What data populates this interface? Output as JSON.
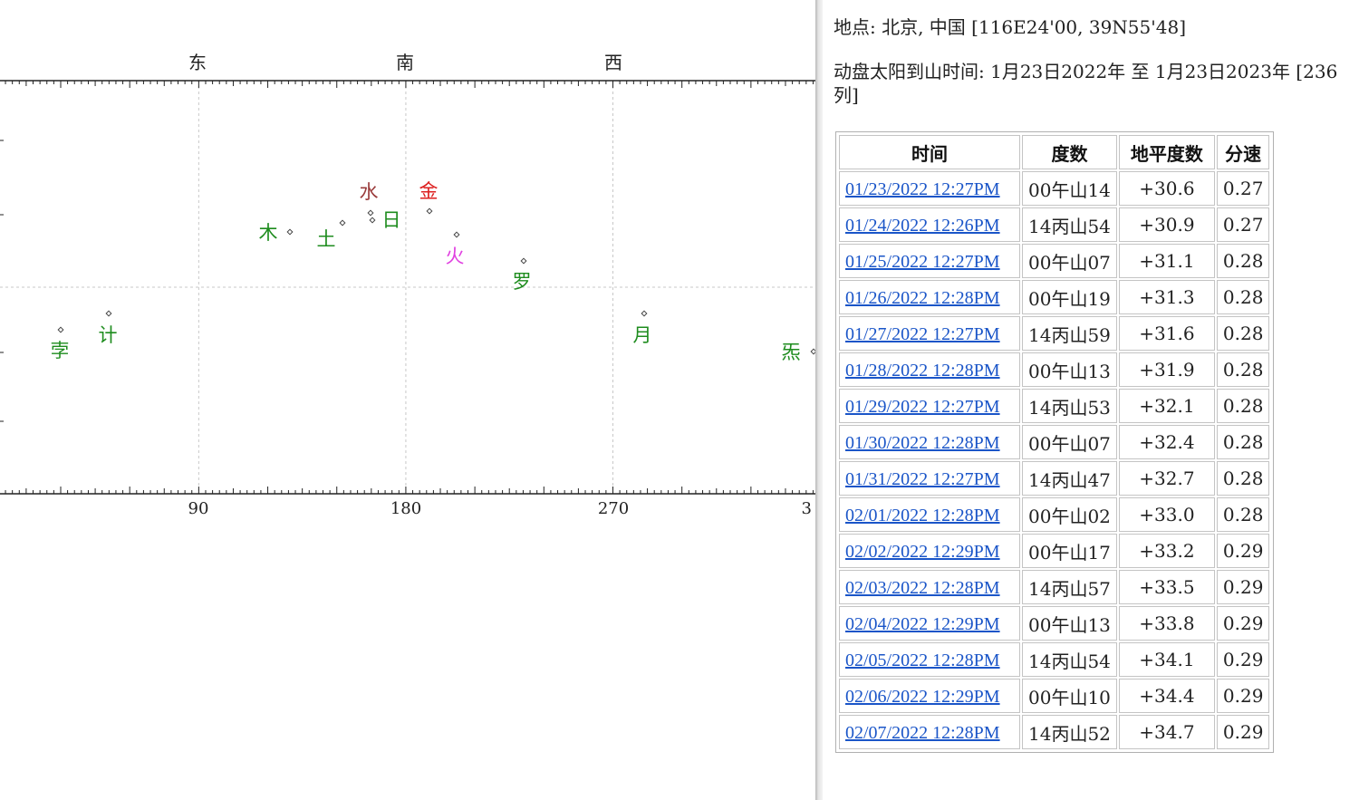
{
  "chart": {
    "directions": [
      "东",
      "南",
      "西"
    ],
    "x_ticks": [
      "90",
      "180",
      "270",
      "3"
    ],
    "colors": {
      "green": "#1e8c1e",
      "red": "#dd2020",
      "brown": "#9a3b3b",
      "magenta": "#e040e0",
      "grid": "#c8c8c8"
    },
    "bodies": [
      {
        "label": "孛",
        "color": "#1e8c1e"
      },
      {
        "label": "计",
        "color": "#1e8c1e"
      },
      {
        "label": "木",
        "color": "#1e8c1e"
      },
      {
        "label": "土",
        "color": "#1e8c1e"
      },
      {
        "label": "水",
        "color": "#9a3b3b"
      },
      {
        "label": "日",
        "color": "#1e8c1e"
      },
      {
        "label": "金",
        "color": "#dd2020"
      },
      {
        "label": "火",
        "color": "#e040e0"
      },
      {
        "label": "罗",
        "color": "#1e8c1e"
      },
      {
        "label": "月",
        "color": "#1e8c1e"
      },
      {
        "label": "炁",
        "color": "#1e8c1e"
      }
    ]
  },
  "info": {
    "location": "地点: 北京, 中国  [116E24'00, 39N55'48]",
    "range": "动盘太阳到山时间: 1月23日2022年  至  1月23日2023年  [236 列]"
  },
  "table": {
    "headers": [
      "时间",
      "度数",
      "地平度数",
      "分速"
    ],
    "rows": [
      [
        "01/23/2022 12:27PM",
        "00午山14",
        "+30.6",
        "0.27"
      ],
      [
        "01/24/2022 12:26PM",
        "14丙山54",
        "+30.9",
        "0.27"
      ],
      [
        "01/25/2022 12:27PM",
        "00午山07",
        "+31.1",
        "0.28"
      ],
      [
        "01/26/2022 12:28PM",
        "00午山19",
        "+31.3",
        "0.28"
      ],
      [
        "01/27/2022 12:27PM",
        "14丙山59",
        "+31.6",
        "0.28"
      ],
      [
        "01/28/2022 12:28PM",
        "00午山13",
        "+31.9",
        "0.28"
      ],
      [
        "01/29/2022 12:27PM",
        "14丙山53",
        "+32.1",
        "0.28"
      ],
      [
        "01/30/2022 12:28PM",
        "00午山07",
        "+32.4",
        "0.28"
      ],
      [
        "01/31/2022 12:27PM",
        "14丙山47",
        "+32.7",
        "0.28"
      ],
      [
        "02/01/2022 12:28PM",
        "00午山02",
        "+33.0",
        "0.28"
      ],
      [
        "02/02/2022 12:29PM",
        "00午山17",
        "+33.2",
        "0.29"
      ],
      [
        "02/03/2022 12:28PM",
        "14丙山57",
        "+33.5",
        "0.29"
      ],
      [
        "02/04/2022 12:29PM",
        "00午山13",
        "+33.8",
        "0.29"
      ],
      [
        "02/05/2022 12:28PM",
        "14丙山54",
        "+34.1",
        "0.29"
      ],
      [
        "02/06/2022 12:29PM",
        "00午山10",
        "+34.4",
        "0.29"
      ],
      [
        "02/07/2022 12:28PM",
        "14丙山52",
        "+34.7",
        "0.29"
      ]
    ]
  }
}
